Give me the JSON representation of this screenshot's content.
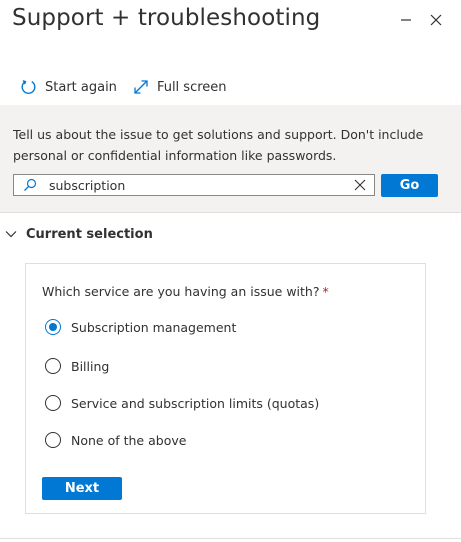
{
  "header": {
    "title": "Support + troubleshooting"
  },
  "toolbar": {
    "start_again_label": "Start again",
    "full_screen_label": "Full screen"
  },
  "info": {
    "text": "Tell us about the issue to get solutions and support. Don't include personal or confidential information like passwords."
  },
  "search": {
    "value": "subscription",
    "go_label": "Go"
  },
  "section": {
    "title": "Current selection"
  },
  "form": {
    "question": "Which service are you having an issue with?",
    "required_marker": "*",
    "options": [
      {
        "label": "Subscription management",
        "checked": true
      },
      {
        "label": "Billing",
        "checked": false
      },
      {
        "label": "Service and subscription limits (quotas)",
        "checked": false
      },
      {
        "label": "None of the above",
        "checked": false
      }
    ],
    "next_label": "Next"
  },
  "colors": {
    "accent": "#0078d4",
    "required": "#a4262c",
    "band": "#f3f2f1"
  }
}
